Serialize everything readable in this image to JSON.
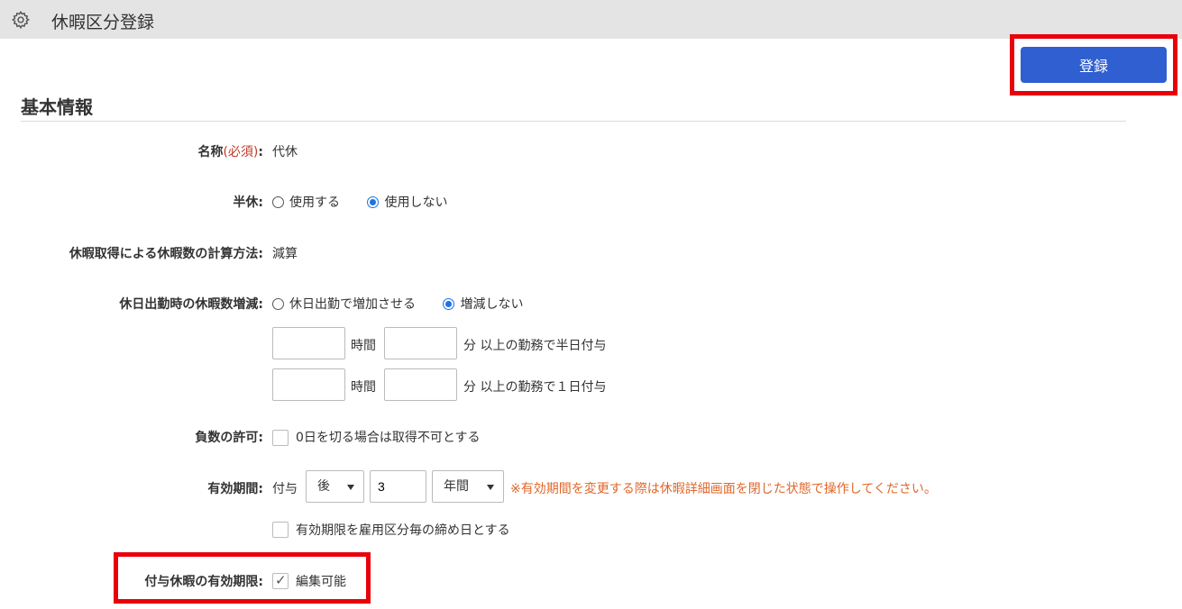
{
  "header": {
    "title": "休暇区分登録",
    "icon": "gear-icon"
  },
  "toolbar": {
    "register_label": "登録"
  },
  "section": {
    "title": "基本情報"
  },
  "fields": {
    "name": {
      "label": "名称",
      "required": "(必須)",
      "colon": ":",
      "value": "代休"
    },
    "half_day": {
      "label": "半休:",
      "options": [
        "使用する",
        "使用しない"
      ],
      "selected": "使用しない"
    },
    "calc_method": {
      "label": "休暇取得による休暇数の計算方法:",
      "value": "減算"
    },
    "holiday_work": {
      "label": "休日出勤時の休暇数増減:",
      "options": [
        "休日出勤で増加させる",
        "増減しない"
      ],
      "selected": "増減しない",
      "row1": {
        "hours": "",
        "hours_unit": "時間",
        "minutes": "",
        "suffix": "分 以上の勤務で半日付与"
      },
      "row2": {
        "hours": "",
        "hours_unit": "時間",
        "minutes": "",
        "suffix": "分 以上の勤務で１日付与"
      }
    },
    "negative": {
      "label": "負数の許可:",
      "checkbox_label": "0日を切る場合は取得不可とする",
      "checked": false
    },
    "validity": {
      "label": "有効期間:",
      "prefix": "付与",
      "direction": "後",
      "amount": "3",
      "unit": "年間",
      "warning": "※有効期間を変更する際は休暇詳細画面を閉じた状態で操作してください。",
      "closing_checkbox_label": "有効期限を雇用区分毎の締め日とする",
      "closing_checked": false
    },
    "granted_validity": {
      "label": "付与休暇の有効期限:",
      "checkbox_label": "編集可能",
      "checked": true
    }
  },
  "colors": {
    "accent": "#2f5fd0",
    "highlight": "#e8000b",
    "warning": "#e0672a",
    "required": "#c0392b"
  }
}
